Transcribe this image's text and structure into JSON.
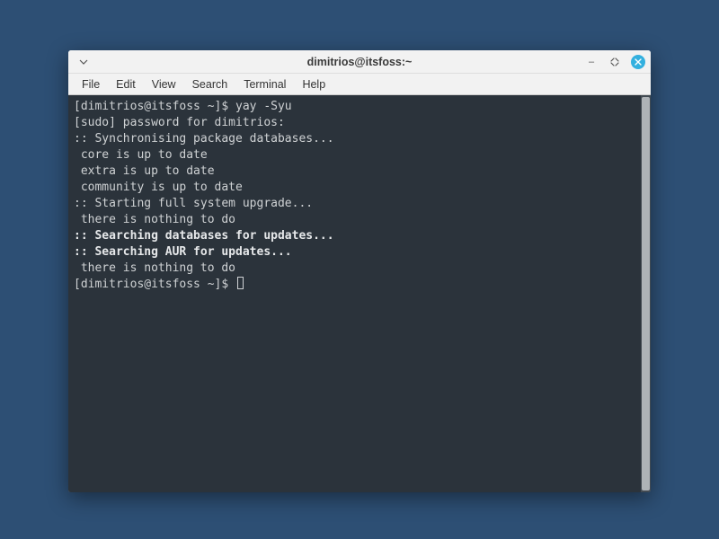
{
  "window": {
    "title": "dimitrios@itsfoss:~",
    "app_icon": "terminal-icon",
    "buttons": {
      "minimize": "–",
      "maximize": "⤢",
      "close": "×"
    }
  },
  "menubar": [
    "File",
    "Edit",
    "View",
    "Search",
    "Terminal",
    "Help"
  ],
  "terminal": {
    "lines": [
      {
        "text": "[dimitrios@itsfoss ~]$ yay -Syu",
        "bold": false
      },
      {
        "text": "[sudo] password for dimitrios:",
        "bold": false
      },
      {
        "text": ":: Synchronising package databases...",
        "bold": false
      },
      {
        "text": " core is up to date",
        "bold": false
      },
      {
        "text": " extra is up to date",
        "bold": false
      },
      {
        "text": " community is up to date",
        "bold": false
      },
      {
        "text": ":: Starting full system upgrade...",
        "bold": false
      },
      {
        "text": " there is nothing to do",
        "bold": false
      },
      {
        "text": ":: Searching databases for updates...",
        "bold": true
      },
      {
        "text": ":: Searching AUR for updates...",
        "bold": true
      },
      {
        "text": " there is nothing to do",
        "bold": false
      }
    ],
    "prompt": "[dimitrios@itsfoss ~]$ "
  }
}
